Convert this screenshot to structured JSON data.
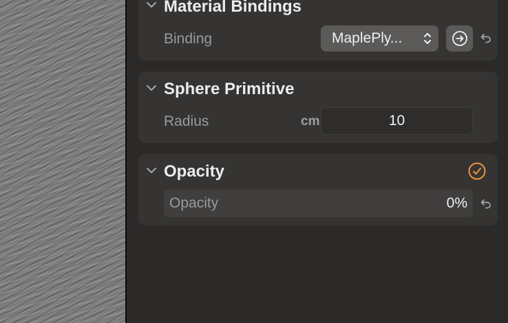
{
  "material_bindings": {
    "title": "Material Bindings",
    "binding_label": "Binding",
    "binding_value": "MaplePly...",
    "icons": [
      "chevron-down-icon",
      "stepper-icon",
      "go-to-icon",
      "revert-icon"
    ]
  },
  "sphere_primitive": {
    "title": "Sphere Primitive",
    "radius_label": "Radius",
    "radius_unit": "cm",
    "radius_value": "10",
    "icons": [
      "chevron-down-icon"
    ]
  },
  "opacity": {
    "title": "Opacity",
    "field_label": "Opacity",
    "field_value": "0%",
    "icons": [
      "chevron-down-icon",
      "checkmark-circle-icon",
      "revert-icon"
    ]
  },
  "colors": {
    "panel_bg": "#2b2a29",
    "section_bg": "#353433",
    "accent_orange": "#f0953a"
  }
}
